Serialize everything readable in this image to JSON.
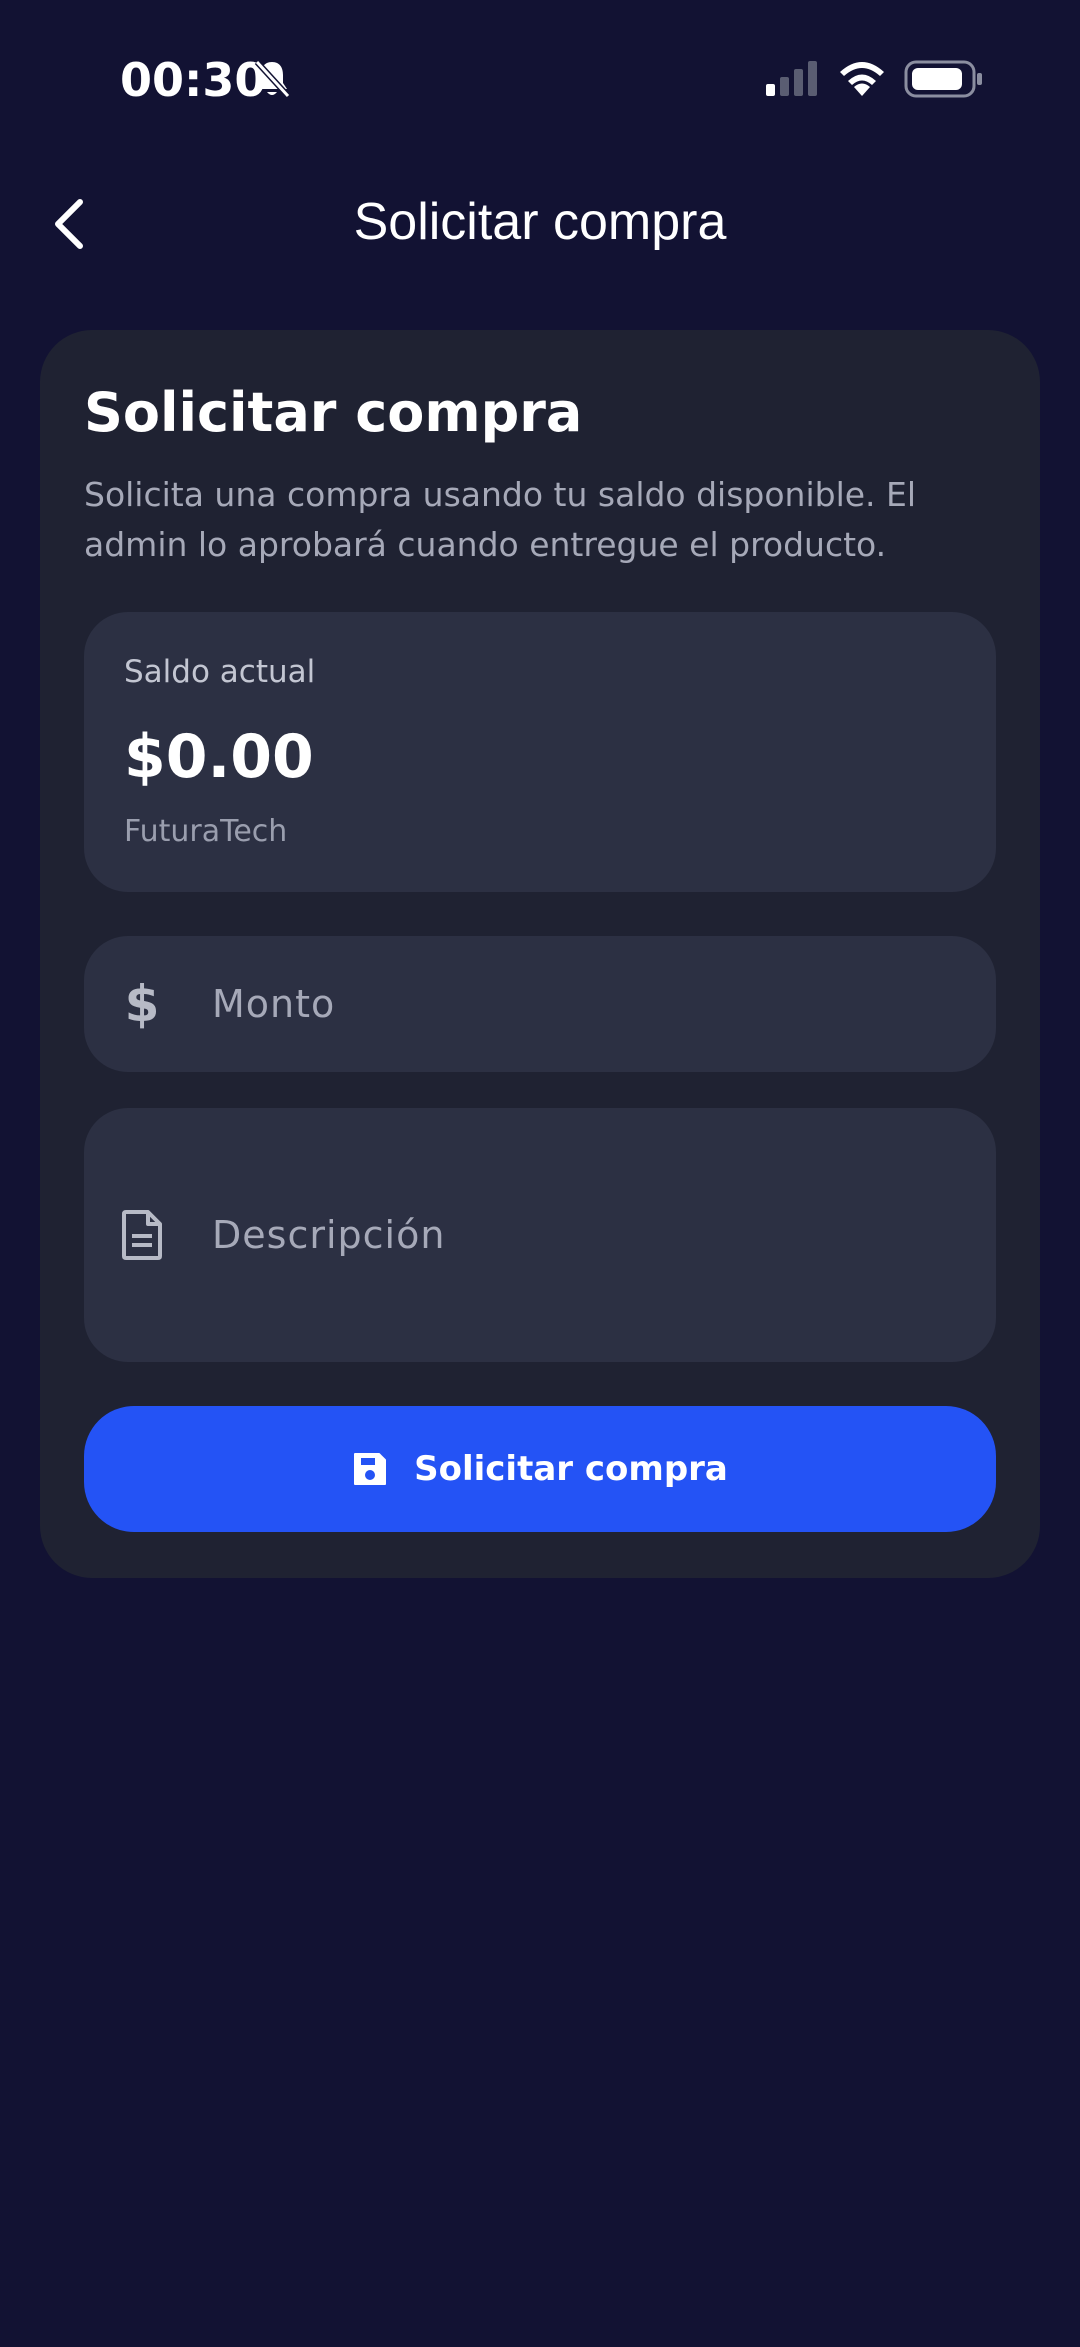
{
  "status_bar": {
    "time": "00:30",
    "icons": [
      "bell-off-icon",
      "signal-icon",
      "wifi-icon",
      "battery-icon"
    ]
  },
  "header": {
    "title": "Solicitar compra",
    "back_icon": "chevron-left-icon"
  },
  "card": {
    "title": "Solicitar compra",
    "description": "Solicita una compra usando tu saldo disponible. El admin lo aprobará cuando entregue el producto."
  },
  "balance": {
    "label": "Saldo actual",
    "value": "$0.00",
    "company": "FuturaTech"
  },
  "form": {
    "amount_placeholder": "Monto",
    "amount_icon": "$",
    "description_placeholder": "Descripción",
    "submit_label": "Solicitar compra"
  },
  "colors": {
    "background": "#121233",
    "card": "#1f2232",
    "field": "#2c3043",
    "accent": "#2453f5",
    "text_primary": "#ffffff",
    "text_secondary": "#a6a9b8"
  }
}
